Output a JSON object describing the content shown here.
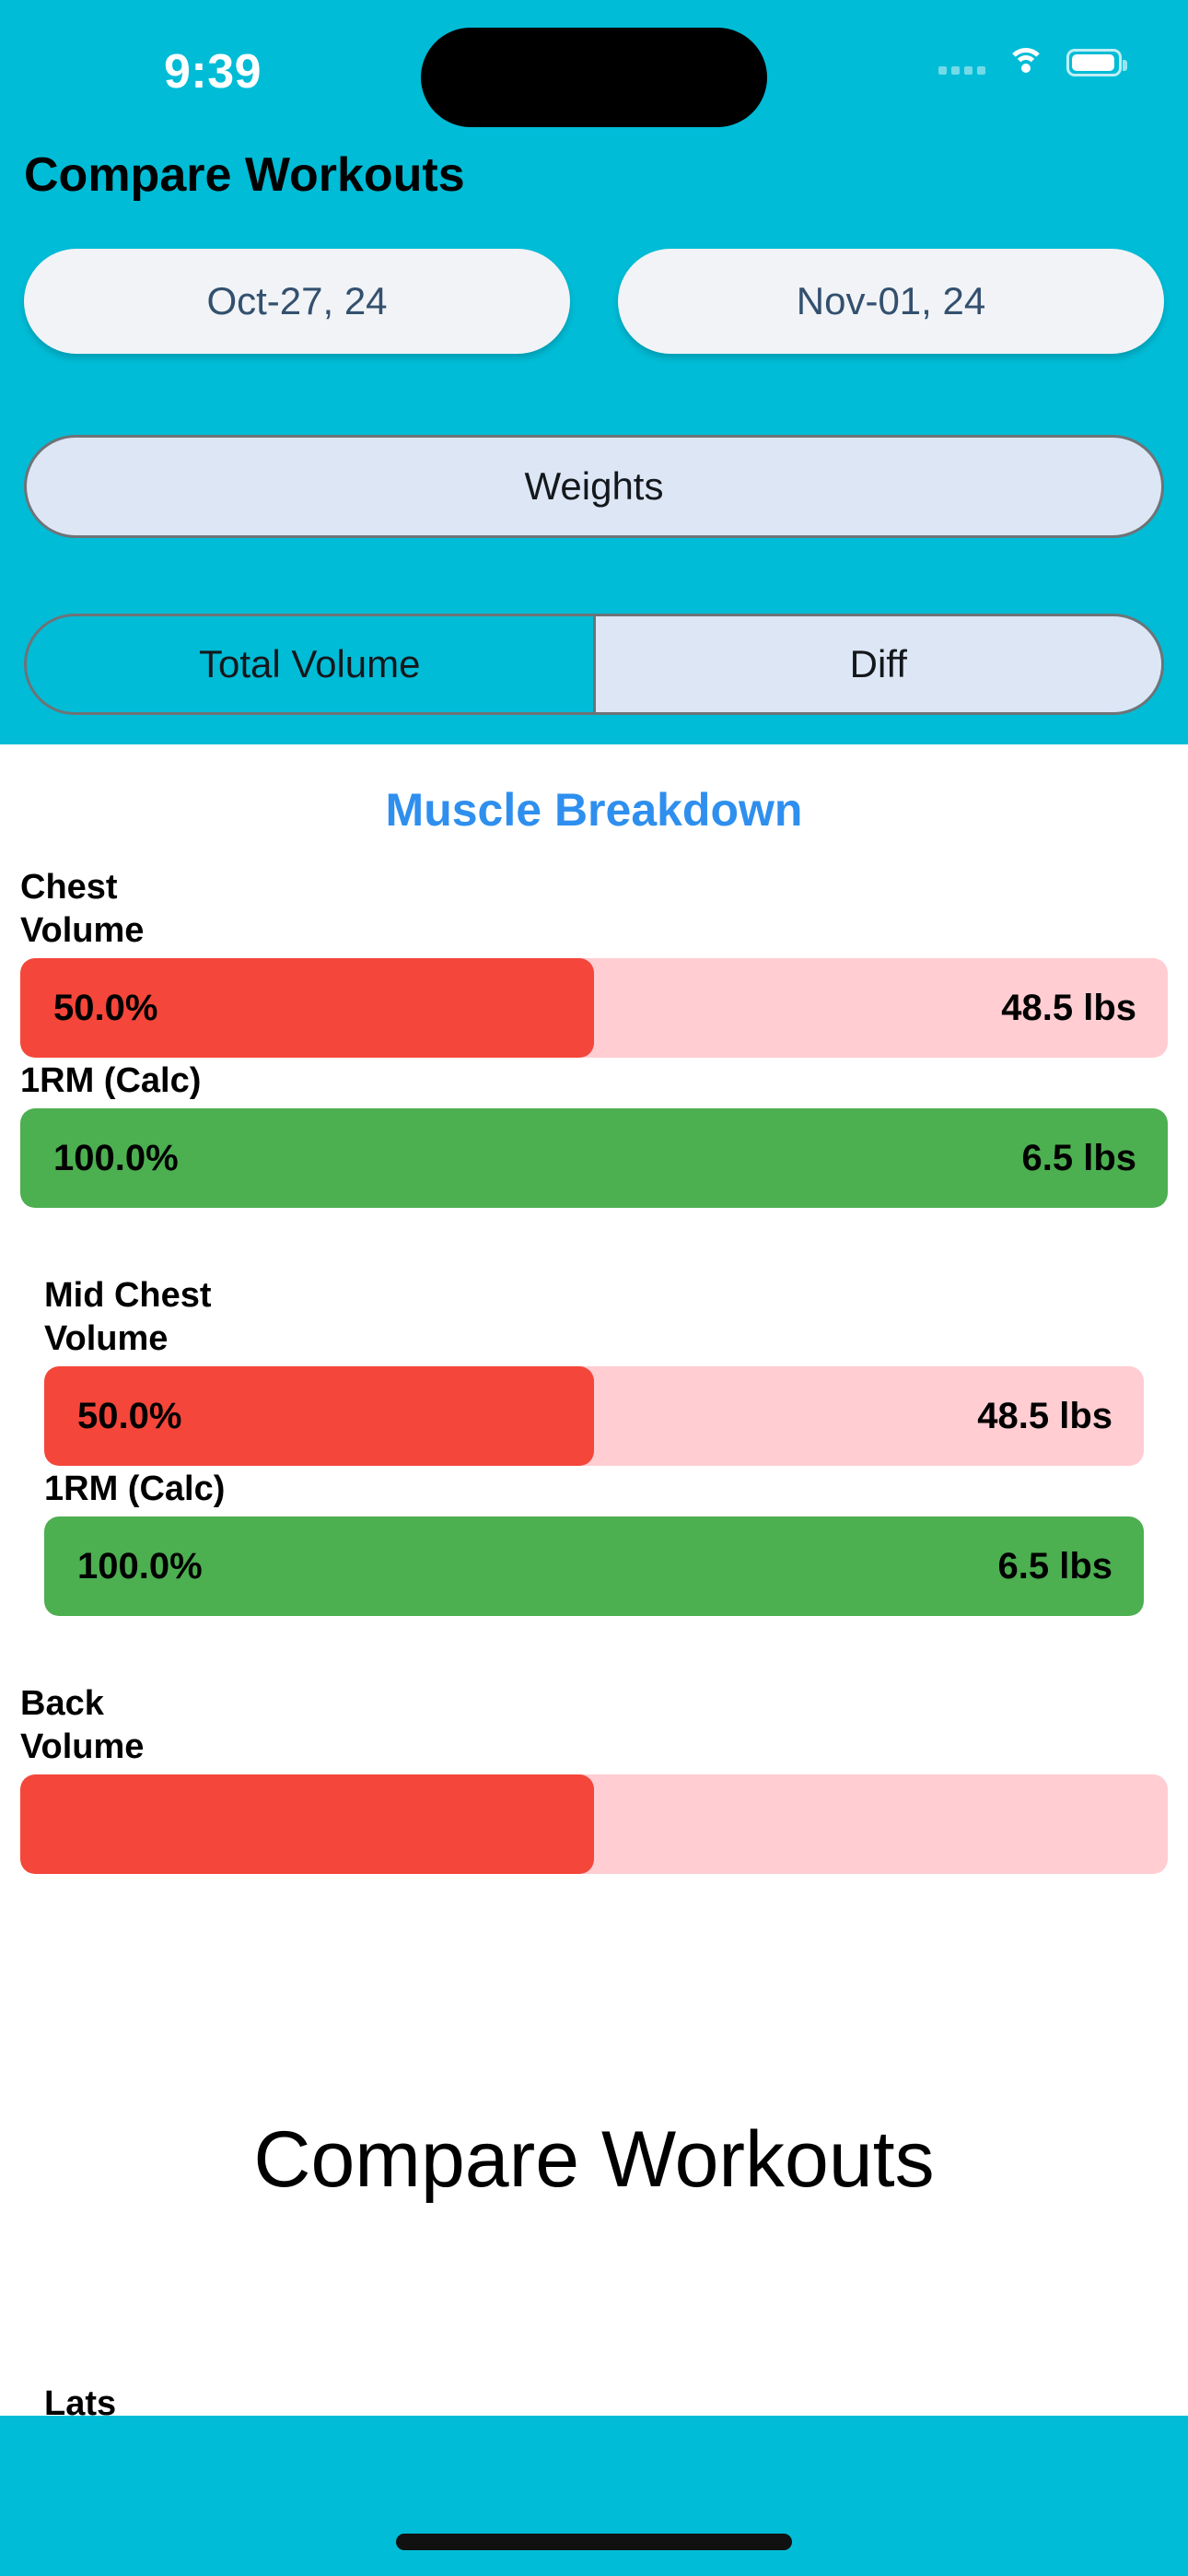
{
  "status_bar": {
    "time": "9:39",
    "cellular_icon": "cellular-dots-icon",
    "wifi_icon": "wifi-icon",
    "battery_icon": "battery-icon"
  },
  "header": {
    "title": "Compare Workouts",
    "background_color": "#00BCD6",
    "date_buttons": [
      {
        "label": "Oct-27, 24"
      },
      {
        "label": "Nov-01, 24"
      }
    ],
    "category_button": {
      "label": "Weights",
      "selected": true
    },
    "segmented_control": {
      "options": [
        {
          "label": "Total Volume",
          "selected": false
        },
        {
          "label": "Diff",
          "selected": true
        }
      ]
    }
  },
  "main": {
    "section_title": "Muscle Breakdown",
    "section_title_color": "#2E8FEE",
    "groups": [
      {
        "name": "Chest",
        "indent": false,
        "metrics": [
          {
            "label": "Volume",
            "percent": "50.0%",
            "fill_ratio": 0.5,
            "value": "48.5 lbs",
            "color": "red"
          },
          {
            "label": "1RM (Calc)",
            "percent": "100.0%",
            "fill_ratio": 1.0,
            "value": "6.5 lbs",
            "color": "green"
          }
        ]
      },
      {
        "name": "Mid Chest",
        "indent": true,
        "metrics": [
          {
            "label": "Volume",
            "percent": "50.0%",
            "fill_ratio": 0.5,
            "value": "48.5 lbs",
            "color": "red"
          },
          {
            "label": "1RM (Calc)",
            "percent": "100.0%",
            "fill_ratio": 1.0,
            "value": "6.5 lbs",
            "color": "green"
          }
        ]
      },
      {
        "name": "Back",
        "indent": false,
        "metrics": [
          {
            "label": "Volume",
            "percent": "",
            "fill_ratio": 0.5,
            "value": "",
            "color": "red"
          }
        ]
      }
    ],
    "overlay_title": "Compare Workouts",
    "trailing_group_name": "Lats"
  },
  "tab_bar": {
    "background_color": "#00BCD6",
    "home_indicator": "home-indicator"
  },
  "colors": {
    "accent_cyan": "#00BCD6",
    "bar_red": "#F4463A",
    "bar_red_track": "#FFCDD2",
    "bar_green": "#4CAF50",
    "bar_green_track": "#C8E6C9",
    "pill_bg": "#F1F3F6",
    "pill_text": "#33506E",
    "selected_bg": "#DCE6F5"
  }
}
